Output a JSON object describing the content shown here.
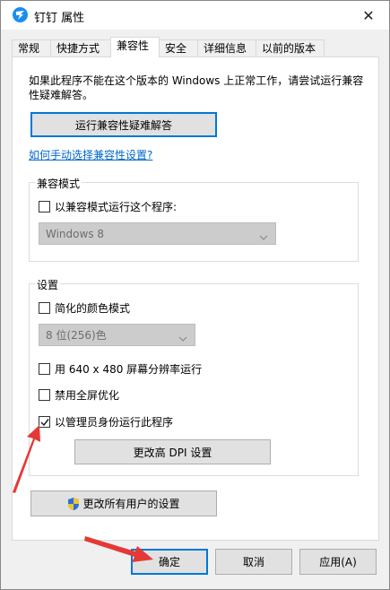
{
  "window": {
    "title": "钉钉 属性",
    "close_symbol": "✕"
  },
  "tabs": [
    {
      "label": "常规",
      "active": false
    },
    {
      "label": "快捷方式",
      "active": false
    },
    {
      "label": "兼容性",
      "active": true
    },
    {
      "label": "安全",
      "active": false
    },
    {
      "label": "详细信息",
      "active": false
    },
    {
      "label": "以前的版本",
      "active": false
    }
  ],
  "compat": {
    "intro": "如果此程序不能在这个版本的 Windows 上正常工作，请尝试运行兼容性疑难解答。",
    "troubleshoot_button": "运行兼容性疑难解答",
    "manual_link": "如何手动选择兼容性设置?"
  },
  "compat_mode": {
    "group_title": "兼容模式",
    "checkbox_label": "以兼容模式运行这个程序:",
    "checked": false,
    "os_select_value": "Windows 8"
  },
  "settings": {
    "group_title": "设置",
    "reduced_color": {
      "label": "简化的颜色模式",
      "checked": false
    },
    "color_select_value": "8 位(256)色",
    "res_640": {
      "label": "用 640 x 480 屏幕分辨率运行",
      "checked": false
    },
    "disable_fullscreen": {
      "label": "禁用全屏优化",
      "checked": false
    },
    "run_as_admin": {
      "label": "以管理员身份运行此程序",
      "checked": true
    },
    "dpi_button": "更改高 DPI 设置"
  },
  "all_users_button": "更改所有用户的设置",
  "footer": {
    "ok": "确定",
    "cancel": "取消",
    "apply": "应用(A)"
  },
  "colors": {
    "accent": "#0078d7",
    "annotation_arrow": "#e53935",
    "link": "#0066cc"
  },
  "icons": [
    "dingtalk-app-icon",
    "close-icon",
    "chevron-down-icon",
    "checkmark-icon",
    "uac-shield-icon"
  ]
}
